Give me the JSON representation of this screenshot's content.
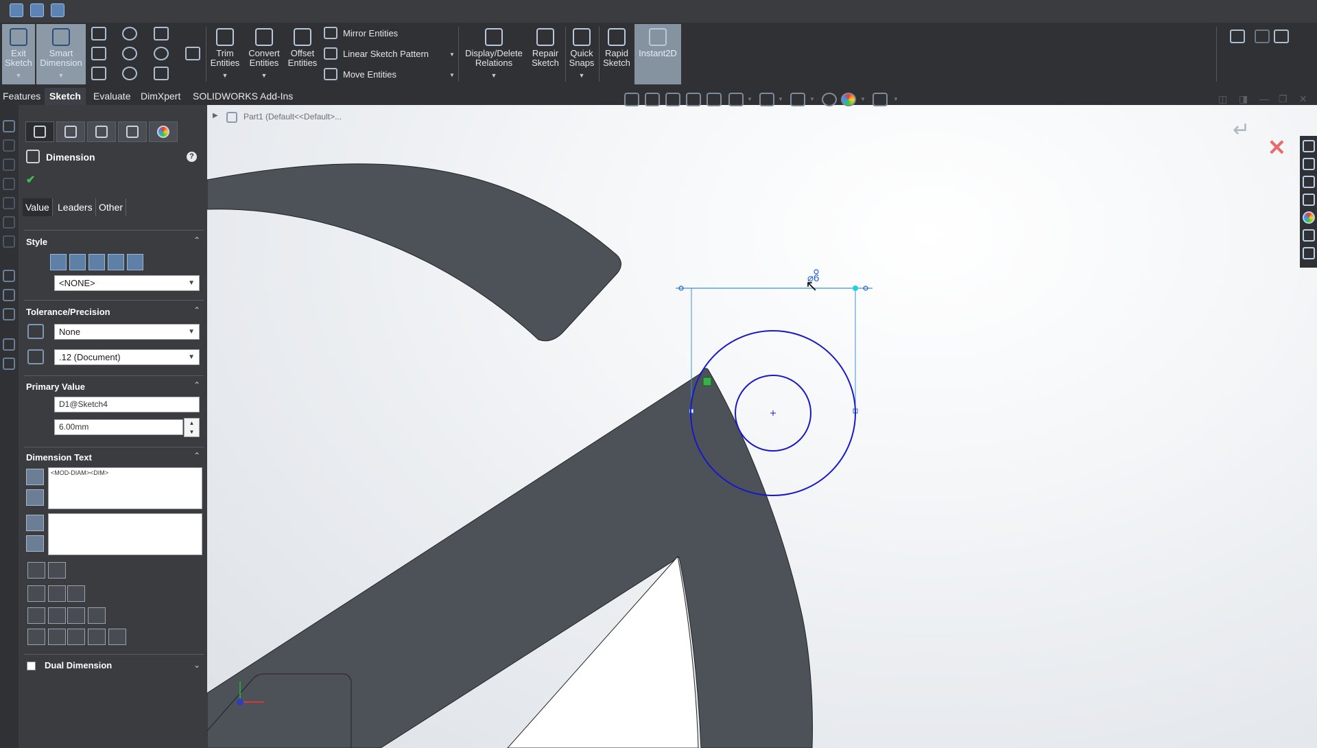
{
  "ribbon": {
    "exit_sketch": "Exit\nSketch",
    "smart_dimension": "Smart\nDimension",
    "trim_entities": "Trim\nEntities",
    "convert_entities": "Convert\nEntities",
    "offset_entities": "Offset\nEntities",
    "mirror_entities": "Mirror Entities",
    "linear_sketch_pattern": "Linear Sketch Pattern",
    "move_entities": "Move Entities",
    "display_delete_relations": "Display/Delete\nRelations",
    "repair_sketch": "Repair\nSketch",
    "quick_snaps": "Quick\nSnaps",
    "rapid_sketch": "Rapid\nSketch",
    "instant2d": "Instant2D"
  },
  "command_tabs": [
    "Features",
    "Sketch",
    "Evaluate",
    "DimXpert",
    "SOLIDWORKS Add-Ins"
  ],
  "active_tab": "Sketch",
  "tree": {
    "part_label": "Part1  (Default<<Default>..."
  },
  "property_manager": {
    "title": "Dimension",
    "help": "?",
    "subtabs": [
      "Value",
      "Leaders",
      "Other"
    ],
    "style": {
      "header": "Style",
      "favorite": "<NONE>"
    },
    "tolerance": {
      "header": "Tolerance/Precision",
      "tolerance_type": "None",
      "precision": ".12 (Document)"
    },
    "primary_value": {
      "header": "Primary Value",
      "name": "D1@Sketch4",
      "value": "6.00mm"
    },
    "dimension_text": {
      "header": "Dimension Text",
      "text": "<MOD-DIAM><DIM>"
    },
    "dual_dimension": {
      "label": "Dual Dimension",
      "checked": false
    }
  },
  "sketch": {
    "dimension_preview": "⌀6"
  },
  "colors": {
    "sketch_blue": "#1818c8",
    "dim_blue": "#3d8fd9",
    "part_fill": "#4d5259",
    "ui_dark": "#2f3135"
  }
}
